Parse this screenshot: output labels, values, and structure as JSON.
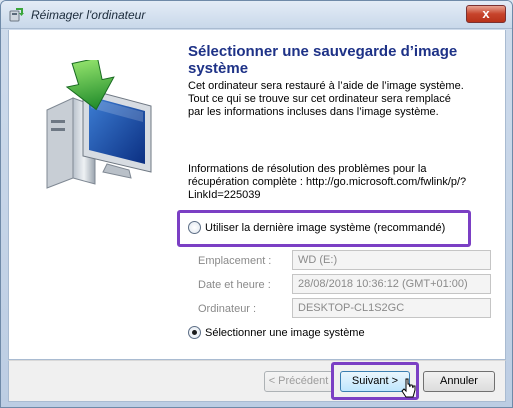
{
  "window": {
    "title": "Réimager l'ordinateur",
    "close_label": "x"
  },
  "page": {
    "heading": "Sélectionner une sauvegarde d’image système",
    "intro": "Cet ordinateur sera restauré à l’aide de l’image système. Tout ce qui se trouve sur cet ordinateur sera remplacé par les informations incluses dans l’image système.",
    "help": "Informations de résolution des problèmes pour la récupération complète : http://go.microsoft.com/fwlink/p/?LinkId=225039"
  },
  "options": {
    "latest": {
      "label": "Utiliser la dernière image système (recommandé)",
      "checked": false
    },
    "select": {
      "label": "Sélectionner une image système",
      "checked": true
    }
  },
  "details": {
    "location_label": "Emplacement :",
    "location_value": "WD (E:)",
    "datetime_label": "Date et heure :",
    "datetime_value": "28/08/2018 10:36:12 (GMT+01:00)",
    "computer_label": "Ordinateur :",
    "computer_value": "DESKTOP-CL1S2GC"
  },
  "buttons": {
    "previous": "< Précédent",
    "next": "Suivant >",
    "cancel": "Annuler"
  },
  "colors": {
    "heading": "#1e3287",
    "highlight": "#7b3fc4"
  }
}
